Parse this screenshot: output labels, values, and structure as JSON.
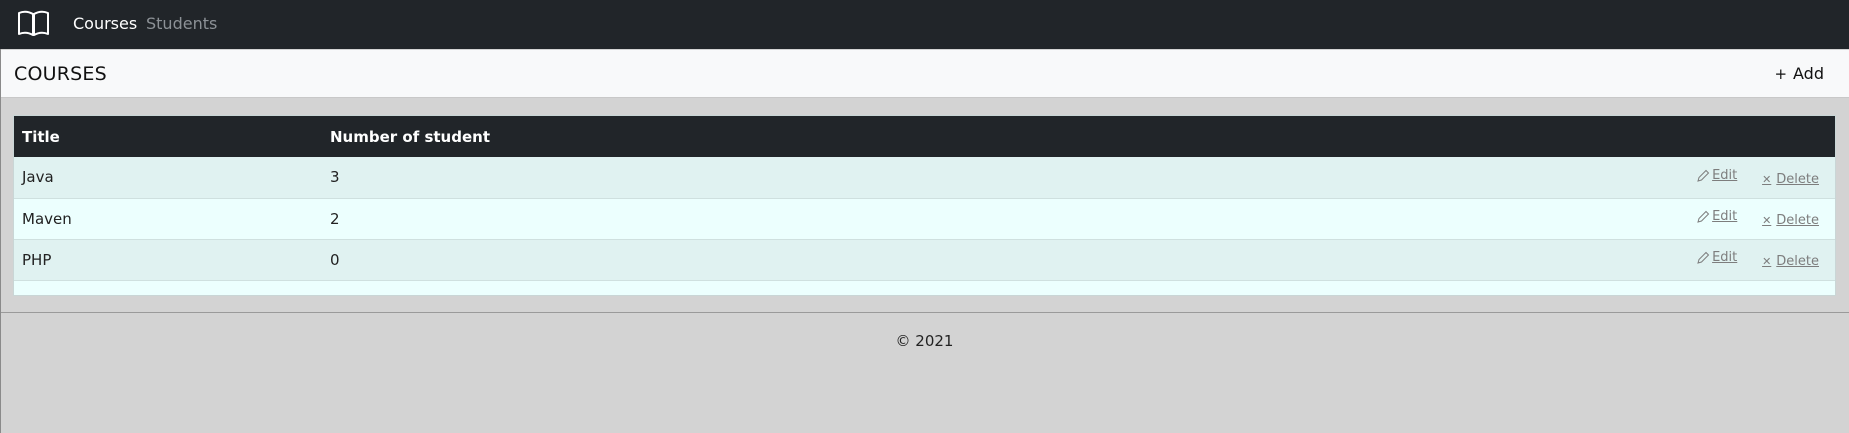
{
  "nav": {
    "logo_icon": "book-open-icon",
    "links": [
      {
        "label": "Courses",
        "active": true
      },
      {
        "label": "Students",
        "active": false
      }
    ]
  },
  "header": {
    "title": "COURSES",
    "add_label": "Add",
    "add_icon": "+"
  },
  "table": {
    "columns": [
      "Title",
      "Number of student"
    ],
    "rows": [
      {
        "title": "Java",
        "count": "3",
        "edit": "Edit",
        "delete": "Delete"
      },
      {
        "title": "Maven",
        "count": "2",
        "edit": "Edit",
        "delete": "Delete"
      },
      {
        "title": "PHP",
        "count": "0",
        "edit": "Edit",
        "delete": "Delete"
      }
    ]
  },
  "footer": {
    "text": "© 2021"
  },
  "colors": {
    "navbar": "#212529",
    "row_odd": "#e0f2f1",
    "row_even": "#ecfffe",
    "background": "#d3d3d3"
  }
}
